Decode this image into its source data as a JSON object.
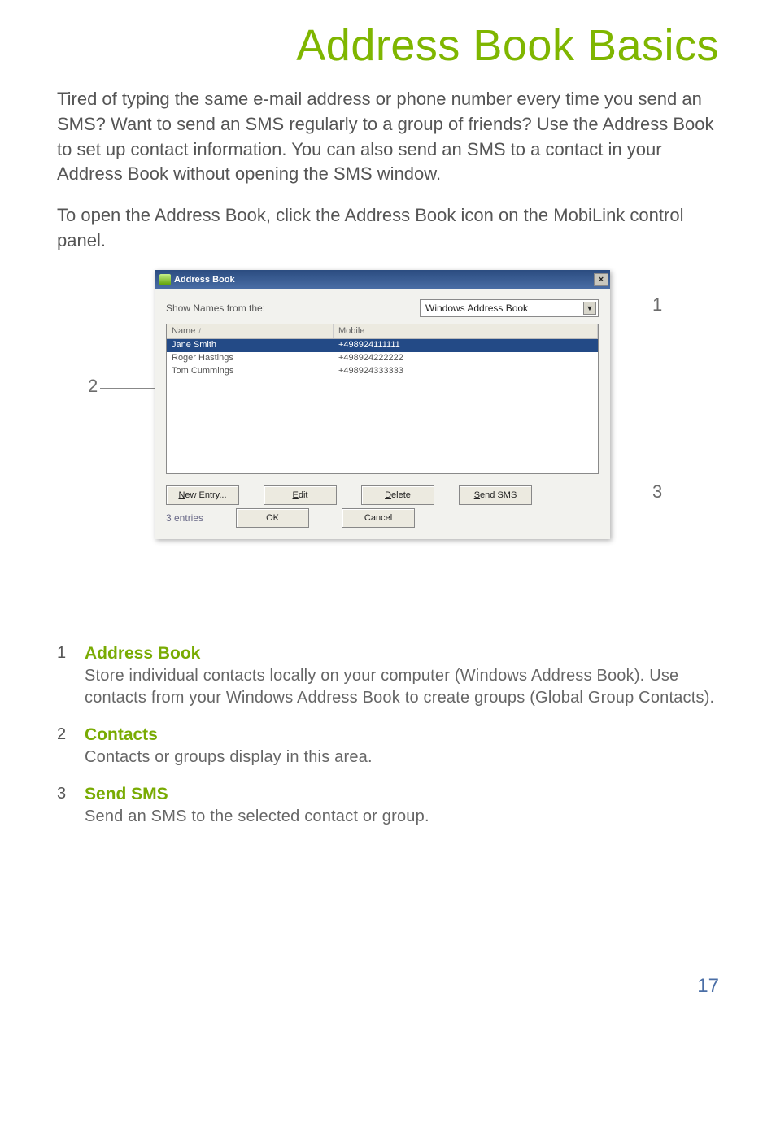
{
  "page": {
    "title": "Address Book Basics",
    "intro_p1": "Tired of typing the same e-mail address or phone number every time you send an SMS? Want to send an SMS regularly to a group of friends? Use the Address Book to set up contact information. You can also send an SMS to a contact in your Address Book without opening the SMS window.",
    "intro_p2": "To open the Address Book, click the Address Book icon on the MobiLink control panel.",
    "page_number": "17"
  },
  "dialog": {
    "title": "Address Book",
    "close_glyph": "×",
    "show_names_label": "Show Names from the:",
    "dropdown_value": "Windows Address Book",
    "dropdown_glyph": "▼",
    "columns": {
      "name": "Name",
      "sort_glyph": "/",
      "mobile": "Mobile"
    },
    "contacts": [
      {
        "name": "Jane Smith",
        "mobile": "+498924111111",
        "selected": true
      },
      {
        "name": "Roger Hastings",
        "mobile": "+498924222222",
        "selected": false
      },
      {
        "name": "Tom Cummings",
        "mobile": "+498924333333",
        "selected": false
      }
    ],
    "buttons": {
      "new_entry_pre": "N",
      "new_entry_rest": "ew Entry...",
      "edit_pre": "E",
      "edit_rest": "dit",
      "delete_pre": "D",
      "delete_rest": "elete",
      "send_sms_pre": "S",
      "send_sms_rest": "end SMS",
      "ok": "OK",
      "cancel": "Cancel"
    },
    "status": "3 entries"
  },
  "callouts": {
    "c1": "1",
    "c2": "2",
    "c3": "3"
  },
  "explain": [
    {
      "num": "1",
      "head": "Address Book",
      "text": "Store individual contacts locally on your computer (Windows Address Book). Use contacts from your Windows Address Book to create groups (Global Group Contacts)."
    },
    {
      "num": "2",
      "head": "Contacts",
      "text": "Contacts or groups display in this area."
    },
    {
      "num": "3",
      "head": "Send SMS",
      "text": "Send an SMS to the selected contact or group."
    }
  ]
}
